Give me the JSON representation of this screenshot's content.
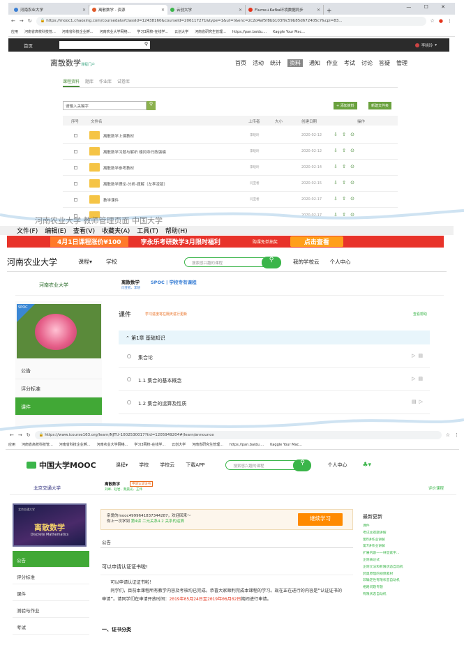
{
  "top_browser": {
    "tabs": [
      {
        "label": "河南农业大学",
        "color": "#3a7fd5"
      },
      {
        "label": "离散数学 - 资源",
        "color": "#e05a2a"
      },
      {
        "label": "云创大学",
        "color": "#3bb54a"
      },
      {
        "label": "Flume+Kafka环境数据同步",
        "color": "#e4341c"
      }
    ],
    "new_tab": "+",
    "window_controls": "— ☐ ✕",
    "url": "https://mooc1.chaoxing.com/coursedata?classId=12438160&courseId=206117271&type=1&ut=t&enc=2c2d4af5f8bb103f9c59b85d672405c7&cpi=83...",
    "bookmarks": [
      "应用",
      "河南省高校科技管...",
      "河南省科技企业孵...",
      "河南农业大学网络...",
      "学习3网校-在线学...",
      "云创大学",
      "河南省研究生管理...",
      "https://pan.baidu....",
      "Kaggle Your Mac..."
    ]
  },
  "chaoxing": {
    "nav_home": "首页",
    "user": "李晓玲",
    "logo": "离散数学",
    "logo_sub": "课程门户",
    "menu": [
      "首页",
      "活动",
      "统计",
      "资料",
      "通知",
      "作业",
      "考试",
      "讨论",
      "答疑",
      "管理"
    ],
    "menu_active": "资料",
    "subtabs": [
      "课程资料",
      "题库",
      "作业库",
      "试卷库"
    ],
    "search_placeholder": "请输入关键字",
    "btn_add": "+ 添加资料",
    "btn_new_folder": "新建文件夹",
    "columns": [
      "序号",
      "文件名",
      "上传者",
      "大小",
      "创建日期",
      "操作"
    ],
    "rows": [
      {
        "name": "离散数学上课教材",
        "uploader": "李晓玲",
        "date": "2020-02-12"
      },
      {
        "name": "离散数学习题与解析 楼冈寺行政强编",
        "uploader": "李晓玲",
        "date": "2020-02-12"
      },
      {
        "name": "离散数学参考教材",
        "uploader": "李晓玲",
        "date": "2020-02-14"
      },
      {
        "name": "离散数学理论-分析-题解（左孝凌版）",
        "uploader": "闫亚者",
        "date": "2020-02-15"
      },
      {
        "name": "教学课件",
        "uploader": "闫亚者",
        "date": "2020-02-17"
      },
      {
        "name": "",
        "uploader": "闫亚者",
        "date": "2020-02-17"
      }
    ],
    "ops_icons": "⇩ ⇧ ⊙"
  },
  "ie": {
    "overlap_text": "河南农业大学   教师管理页面   中国大学",
    "menubar": [
      "文件(F)",
      "编辑(E)",
      "查看(V)",
      "收藏夹(A)",
      "工具(T)",
      "帮助(H)"
    ],
    "banner_a": "4月1日课程涨价¥100",
    "banner_b": "李永乐考研数学3月限时福利",
    "banner_c": "购课免单抽奖",
    "banner_d": "点击查看",
    "brand": "河南农业大学",
    "nav": [
      "课程▾",
      "学校"
    ],
    "search_placeholder": "搜索感兴趣的课程",
    "my_school": "我的学校云",
    "personal": "个人中心",
    "school_logo": "河南农业大学",
    "course_title": "离散数学",
    "spoc_label": "SPOC | 学校专有课程",
    "course_sub": "闫亚者、李晓",
    "spoc_tag": "SPOC",
    "left_items": [
      "公告",
      "评分标准",
      "课件"
    ],
    "left_active": "课件",
    "section_title": "课件",
    "section_note": "学习进度将在隔天进行更新",
    "help": "查看帮助",
    "chapter": "第1章  基础知识",
    "chapter_items": [
      "集合论",
      "1.1 集合的基本概念",
      "1.2 集合的运算及性质"
    ]
  },
  "mooc_browser": {
    "url": "https://www.icourse163.org/learn/NJTU-1002530017?tid=1205949204#/learn/announce",
    "bookmarks": [
      "应用",
      "河南省高校科技管...",
      "河南省科技企业孵...",
      "河南农业大学网络...",
      "学习3网校-在线学...",
      "云创大学",
      "河南省研究生管理...",
      "https://pan.baidu....",
      "Kaggle Your Mac..."
    ]
  },
  "mooc": {
    "brand": "中国大学MOOC",
    "nav": [
      "课程▾",
      "学校",
      "学校云",
      "下载APP"
    ],
    "search_placeholder": "搜索感兴趣的课程",
    "personal": "个人中心",
    "school_logo": "北京交通大学",
    "course_title": "离散数学",
    "cert_badge": "申请认证证书",
    "course_sub": "刘峰、赵岩、魏晨光、王伟",
    "evaluate": "评价课程",
    "cover_title": "离散数学",
    "cover_sub": "Discrete Mathematics",
    "cover_school": "北京交通大学",
    "left_items": [
      "公告",
      "评分标准",
      "课件",
      "测验与作业",
      "考试"
    ],
    "left_active": "公告",
    "welcome_1": "亲爱的mooc4999641837344287，欢迎回来～",
    "welcome_2a": "你上一次学到 ",
    "welcome_2b": "第4讲  二元关系4.2 关系的运算",
    "continue_btn": "继续学习",
    "announce_label": "公告",
    "announce_title": "可以申请认证证书啦!",
    "body_1": "可以申请认证证书啦！",
    "body_2": "同学们，目前本课程所有教学内容及考核均已完成。恭喜大家顺利完成本课程的学习。现在正在进行的内容是“认证证书的申请”。请同学们在申请开放时间：",
    "body_red": "2019年05月24日至2019年06月02日",
    "body_3": "期间进行申请。",
    "section_h": "一、证书分类",
    "right_title": "最新更新",
    "right_items": [
      "课件",
      "考试主观题讲解",
      "第8讲作业讲解",
      "第7讲作业讲解",
      "扩展内容——林登素字...",
      "正则表达式",
      "正则文法和有限状态自动机",
      "鸽巢原理的视频素材",
      "非确定性有限状态自动机",
      "格路问题专题",
      "有限状态自动机"
    ]
  }
}
